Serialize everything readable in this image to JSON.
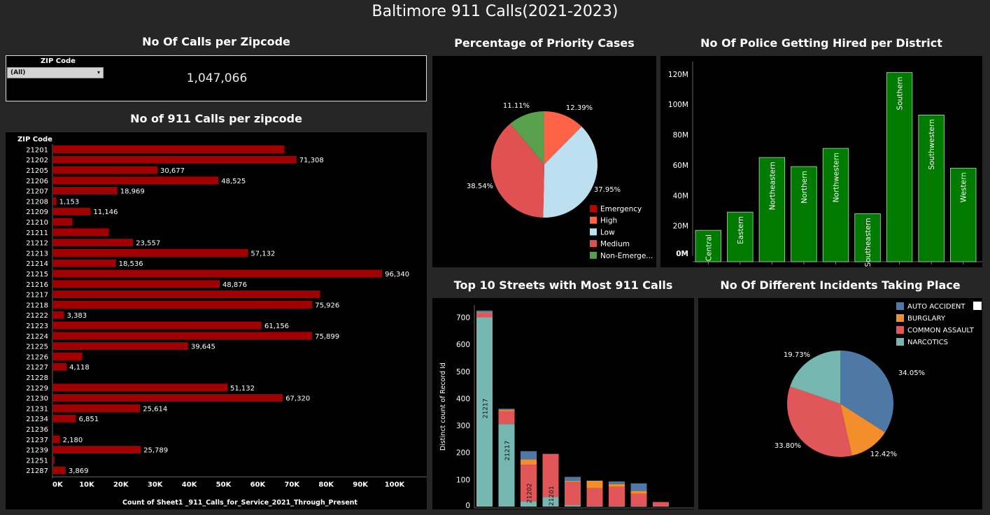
{
  "dashboard": {
    "title": "Baltimore 911 Calls(2021-2023)",
    "kpi": {
      "title": "No Of Calls per Zipcode",
      "filter_label": "ZIP Code",
      "filter_value": "(All)",
      "value": "1,047,066"
    }
  },
  "chart_data": [
    {
      "type": "bar",
      "orientation": "horizontal",
      "title": "No of 911 Calls per zipcode",
      "category_header": "ZIP Code",
      "xlabel": "Count of Sheet1 _911_Calls_for_Service_2021_Through_Present",
      "xlim": [
        0,
        110000
      ],
      "xticks": [
        "0K",
        "10K",
        "20K",
        "30K",
        "40K",
        "50K",
        "60K",
        "70K",
        "80K",
        "90K",
        "100K"
      ],
      "color": "#a00000",
      "categories": [
        "21201",
        "21202",
        "21205",
        "21206",
        "21207",
        "21208",
        "21209",
        "21210",
        "21211",
        "21212",
        "21213",
        "21214",
        "21215",
        "21216",
        "21217",
        "21218",
        "21222",
        "21223",
        "21224",
        "21225",
        "21226",
        "21227",
        "21228",
        "21229",
        "21230",
        "21231",
        "21234",
        "21236",
        "21237",
        "21239",
        "21251",
        "21287"
      ],
      "values": [
        67800,
        71308,
        30677,
        48525,
        18969,
        1153,
        11146,
        5800,
        16500,
        23557,
        57132,
        18536,
        96340,
        48876,
        78200,
        75926,
        3383,
        61156,
        75899,
        39645,
        8700,
        4118,
        0,
        51132,
        67320,
        25614,
        6851,
        0,
        2180,
        25789,
        600,
        3869
      ],
      "labels": [
        "",
        "71,308",
        "30,677",
        "48,525",
        "18,969",
        "1,153",
        "11,146",
        "",
        "",
        "23,557",
        "57,132",
        "18,536",
        "96,340",
        "48,876",
        "",
        "75,926",
        "3,383",
        "61,156",
        "75,899",
        "39,645",
        "",
        "4,118",
        "",
        "51,132",
        "67,320",
        "25,614",
        "6,851",
        "",
        "2,180",
        "25,789",
        "",
        "3,869"
      ]
    },
    {
      "type": "pie",
      "title": "Percentage of Priority Cases",
      "labels": [
        "Emergency",
        "High",
        "Low",
        "Medium",
        "Non-Emerge..."
      ],
      "colors": [
        "#c00000",
        "#ff6347",
        "#bde0f0",
        "#e05252",
        "#58a04c"
      ],
      "values": [
        0.01,
        12.39,
        37.95,
        38.54,
        11.11
      ],
      "value_labels": [
        "",
        "12.39%",
        "37.95%",
        "38.54%",
        "11.11%"
      ]
    },
    {
      "type": "bar",
      "title": "No Of Police Getting Hired per District",
      "categories": [
        "Central",
        "Eastern",
        "Northeastern",
        "Northern",
        "Northwestern",
        "Southeastern",
        "Southern",
        "Southwestern",
        "Western"
      ],
      "values": [
        17,
        29,
        65,
        59,
        71,
        28,
        121,
        93,
        58
      ],
      "unit": "M",
      "ylim": [
        0,
        125
      ],
      "yticks": [
        "0M",
        "20M",
        "40M",
        "60M",
        "80M",
        "100M",
        "120M"
      ],
      "color": "#007a00"
    },
    {
      "type": "bar",
      "stacked": true,
      "title": "Top 10 Streets with Most 911 Calls",
      "ylabel": "Distinct count of Record Id",
      "ylim": [
        0,
        740
      ],
      "yticks": [
        "0",
        "100",
        "200",
        "300",
        "400",
        "500",
        "600",
        "700"
      ],
      "bar_labels": [
        "21217",
        "21217",
        "21202",
        "21201",
        "21215",
        "",
        "",
        "",
        ""
      ],
      "series": [
        {
          "name": "NARCOTICS",
          "color": "#76b7b2",
          "values": [
            700,
            305,
            20,
            35,
            5,
            3,
            3,
            3,
            2
          ]
        },
        {
          "name": "COMMON ASSAULT",
          "color": "#e15759",
          "values": [
            15,
            48,
            135,
            160,
            85,
            65,
            70,
            45,
            15
          ]
        },
        {
          "name": "BURGLARY",
          "color": "#f28e2b",
          "values": [
            3,
            5,
            20,
            0,
            5,
            28,
            10,
            10,
            0
          ]
        },
        {
          "name": "AUTO ACCIDENT",
          "color": "#4e79a7",
          "values": [
            7,
            4,
            30,
            0,
            15,
            0,
            10,
            28,
            0
          ]
        }
      ]
    },
    {
      "type": "pie",
      "title": "No Of Different Incidents Taking Place",
      "labels": [
        "AUTO ACCIDENT",
        "BURGLARY",
        "COMMON ASSAULT",
        "NARCOTICS"
      ],
      "colors": [
        "#4e79a7",
        "#f28e2b",
        "#e15759",
        "#76b7b2"
      ],
      "values": [
        34.05,
        12.42,
        33.8,
        19.73
      ],
      "value_labels": [
        "34.05%",
        "12.42%",
        "33.80%",
        "19.73%"
      ]
    }
  ]
}
